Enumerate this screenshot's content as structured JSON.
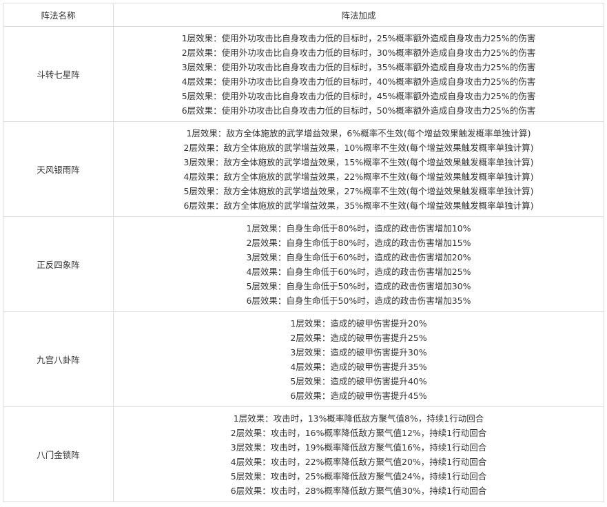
{
  "table": {
    "headers": {
      "name": "阵法名称",
      "bonus": "阵法加成"
    },
    "rows": [
      {
        "name": "斗转七星阵",
        "effects": [
          "1层效果：使用外功攻击比自身攻击力低的目标时，25%概率额外造成自身攻击力25%的伤害",
          "2层效果：使用外功攻击比自身攻击力低的目标时，30%概率额外造成自身攻击力25%的伤害",
          "3层效果：使用外功攻击比自身攻击力低的目标时，35%概率额外造成自身攻击力25%的伤害",
          "4层效果：使用外功攻击比自身攻击力低的目标时，40%概率额外造成自身攻击力25%的伤害",
          "5层效果：使用外功攻击比自身攻击力低的目标时，45%概率额外造成自身攻击力25%的伤害",
          "6层效果：使用外功攻击比自身攻击力低的目标时，50%概率额外造成自身攻击力25%的伤害"
        ]
      },
      {
        "name": "天风银雨阵",
        "effects": [
          "1层效果：敌方全体施放的武学增益效果，6%概率不生效(每个增益效果触发概率单独计算)",
          "2层效果：敌方全体施放的武学增益效果，10%概率不生效(每个增益效果触发概率单独计算)",
          "3层效果：敌方全体施放的武学增益效果，15%概率不生效(每个增益效果触发概率单独计算)",
          "4层效果：敌方全体施放的武学增益效果，22%概率不生效(每个增益效果触发概率单独计算)",
          "5层效果：敌方全体施放的武学增益效果，27%概率不生效(每个增益效果触发概率单独计算)",
          "6层效果：敌方全体施放的武学增益效果，35%概率不生效(每个增益效果触发概率单独计算)"
        ]
      },
      {
        "name": "正反四象阵",
        "effects": [
          "1层效果：自身生命低于80%时，造成的政击伤害增加10%",
          "2层效果：自身生命低于80%时，造成的政击伤害增加15%",
          "3层效果：自身生命低于60%时，造成的政击伤害增加20%",
          "4层效果：自身生命低于60%时，造成的政击伤害增加25%",
          "5层效果：自身生命低于50%时，造成的政击伤害增加30%",
          "6层效果：自身生命低于50%时，造成的政击伤害增加35%"
        ]
      },
      {
        "name": "九宫八卦阵",
        "effects": [
          "1层效果：造成的破甲伤害提升20%",
          "2层效果：造成的破甲伤害提升25%",
          "3层效果：造成的破甲伤害提升30%",
          "4层效果：造成的破甲伤害提升35%",
          "5层效果：造成的破甲伤害提升40%",
          "6层效果：造成的破甲伤害提升45%"
        ]
      },
      {
        "name": "八门金锁阵",
        "effects": [
          "1层效果：攻击时，13%概率降低敌方聚气值8%，持续1行动回合",
          "2层效果：攻击时，16%概率降低敌方聚气值12%，持续1行动回合",
          "3层效果：攻击时，19%概率降低敌方聚气值16%，持续1行动回合",
          "4层效果：攻击时，22%概率降低敌方聚气值20%，持续1行动回合",
          "5层效果：攻击时，25%概率降低敌方聚气值24%，持续1行动回合",
          "6层效果：攻击时，28%概率降低敌方聚气值30%，持续1行动回合"
        ]
      }
    ]
  }
}
